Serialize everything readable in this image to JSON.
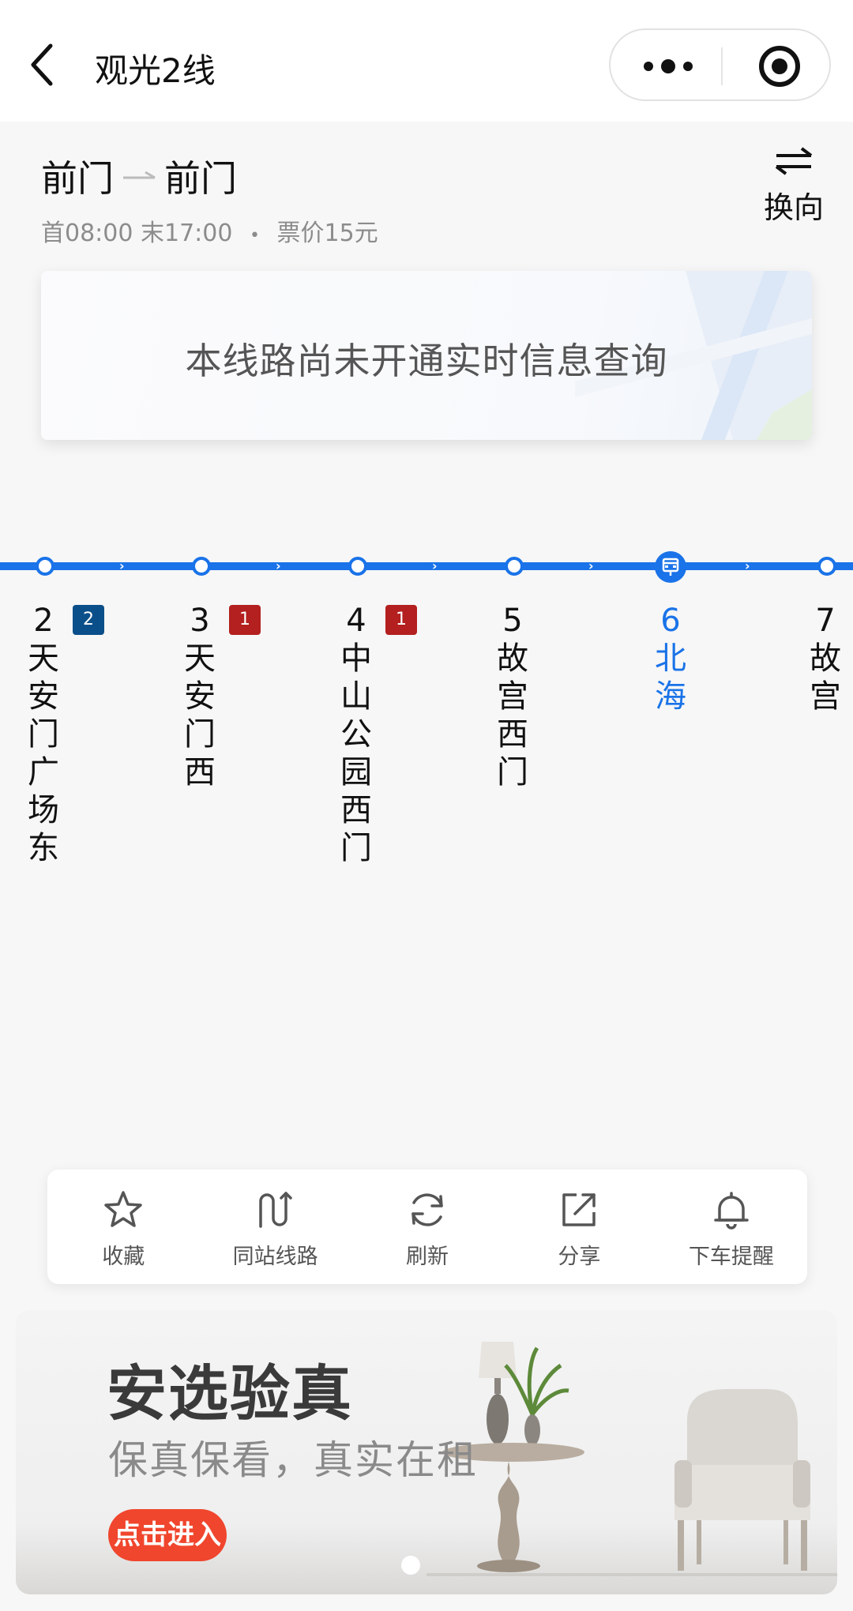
{
  "nav": {
    "title": "观光2线"
  },
  "route": {
    "from": "前门",
    "to": "前门",
    "schedule": "首08:00 末17:00",
    "separator": "•",
    "fare": "票价15元",
    "swap_label": "换向"
  },
  "notice": {
    "text": "本线路尚未开通实时信息查询"
  },
  "stops": [
    {
      "num": "2",
      "name": "天安门广场东",
      "badge": "2",
      "badge_color": "#0b4f8a"
    },
    {
      "num": "3",
      "name": "天安门西",
      "badge": "1",
      "badge_color": "#b3201f"
    },
    {
      "num": "4",
      "name": "中山公园西门",
      "badge": "1",
      "badge_color": "#b3201f"
    },
    {
      "num": "5",
      "name": "故宫西门"
    },
    {
      "num": "6",
      "name": "北海",
      "current": true
    },
    {
      "num": "7",
      "name": "故宫"
    }
  ],
  "toolbar": {
    "favorite": "收藏",
    "same_station_lines": "同站线路",
    "refresh": "刷新",
    "share": "分享",
    "alight_reminder": "下车提醒"
  },
  "banner": {
    "title": "安选验真",
    "subtitle": "保真保看，真实在租",
    "button": "点击进入"
  },
  "colors": {
    "accent": "#1a73e8",
    "badge_blue": "#0b4f8a",
    "badge_red": "#b3201f",
    "banner_button": "#f0462d"
  }
}
